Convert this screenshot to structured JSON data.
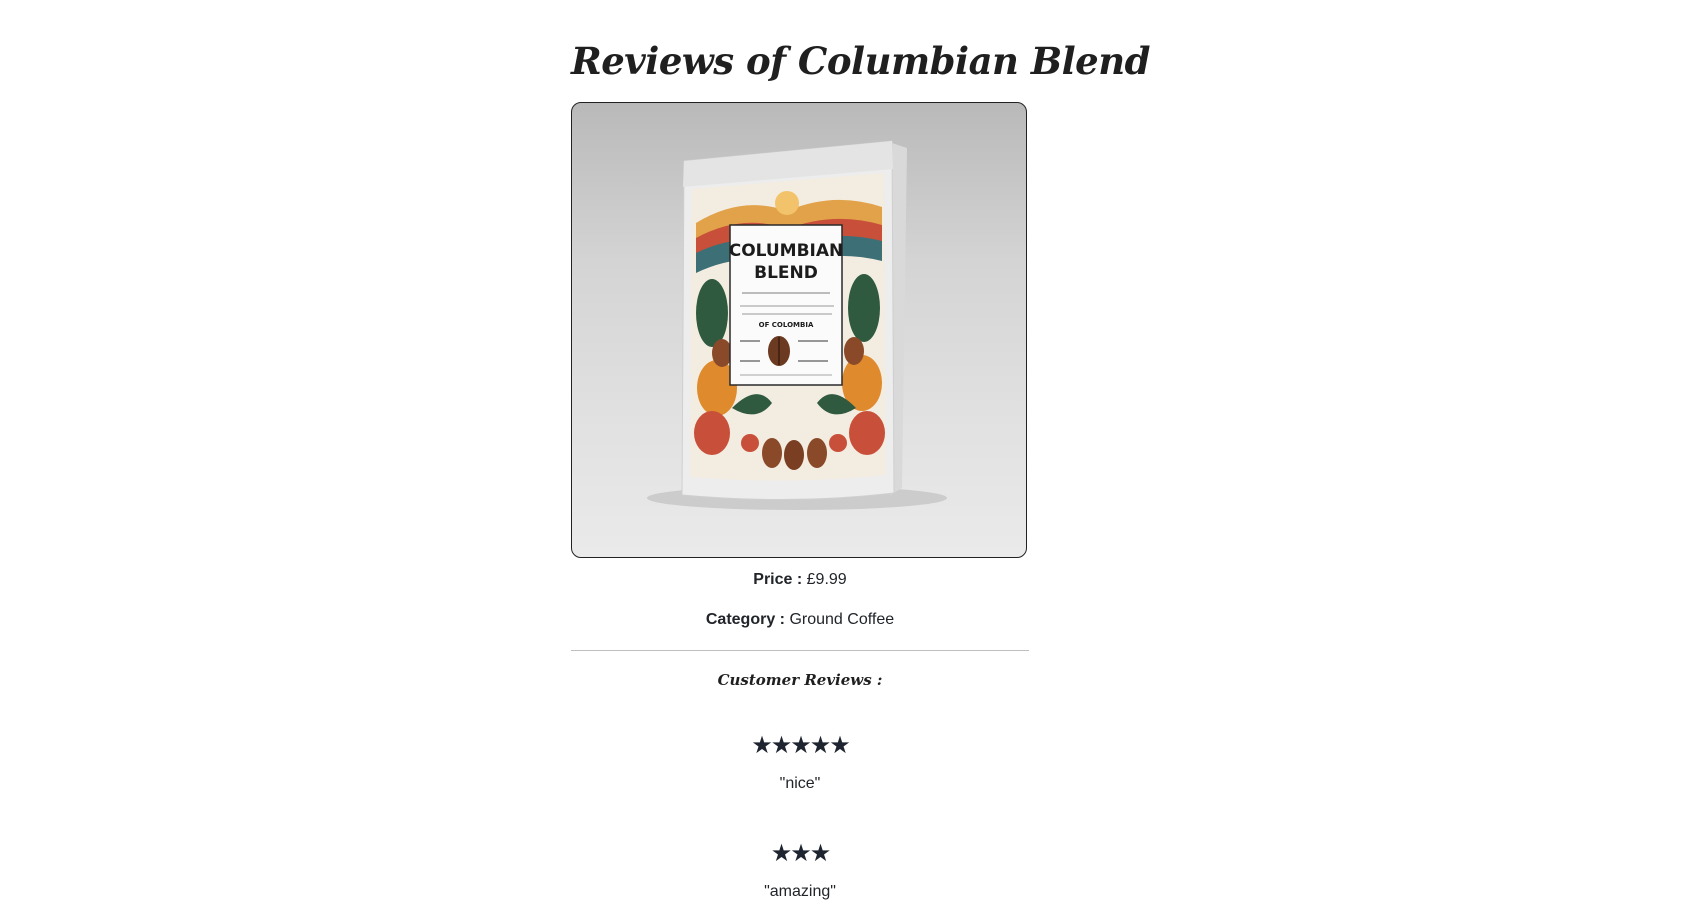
{
  "page": {
    "title": "Reviews of Columbian Blend"
  },
  "product": {
    "image_alt": "Columbian Blend coffee bag",
    "package_text": {
      "line1": "COLUMBIAN",
      "line2": "BLEND",
      "origin": "OF COLOMBIA"
    },
    "price_label": "Price :",
    "price_value": "£9.99",
    "category_label": "Category :",
    "category_value": "Ground Coffee"
  },
  "reviews_section": {
    "heading": "Customer Reviews :"
  },
  "reviews": [
    {
      "stars": "★★★★★",
      "rating": 5,
      "text": "\"nice\""
    },
    {
      "stars": "★★★",
      "rating": 3,
      "text": "\"amazing\""
    }
  ],
  "colors": {
    "text": "#212529",
    "star": "#1e2530",
    "divider": "#bfbfbf"
  }
}
